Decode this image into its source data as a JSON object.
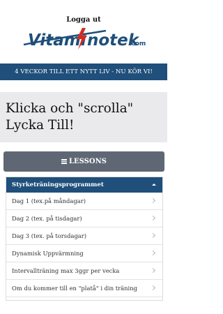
{
  "header": {
    "logout_label": "Logga ut",
    "logo": {
      "text_left": "Vitami",
      "text_right": "notek",
      "domain": ".com",
      "brand_color": "#1f4f7a",
      "accent_color": "#d52b1e"
    }
  },
  "banner": {
    "text": "4 VECKOR TILL ETT NYTT LIV - NU KÖR VI!"
  },
  "hero": {
    "line1": "Klicka och \"scrolla\"",
    "line2": "Lycka Till!"
  },
  "lessons_button": {
    "label": "LESSONS",
    "icon": "menu-icon"
  },
  "program": {
    "title": "Styrketräningsprogrammet",
    "expanded": true,
    "items": [
      {
        "label": "Dag 1 (tex.på måndagar)"
      },
      {
        "label": "Dag 2 (tex. på tisdagar)"
      },
      {
        "label": "Dag 3 (tex. på torsdagar)"
      },
      {
        "label": "Dynamisk Uppvärmning"
      },
      {
        "label": "Intervallträning max 3ggr per vecka"
      },
      {
        "label": "Om du kommer till en \"platå\" i din träning"
      }
    ]
  },
  "colors": {
    "primary": "#1f4f7a",
    "button": "#5f6775",
    "hero_bg": "#eaeaec"
  }
}
